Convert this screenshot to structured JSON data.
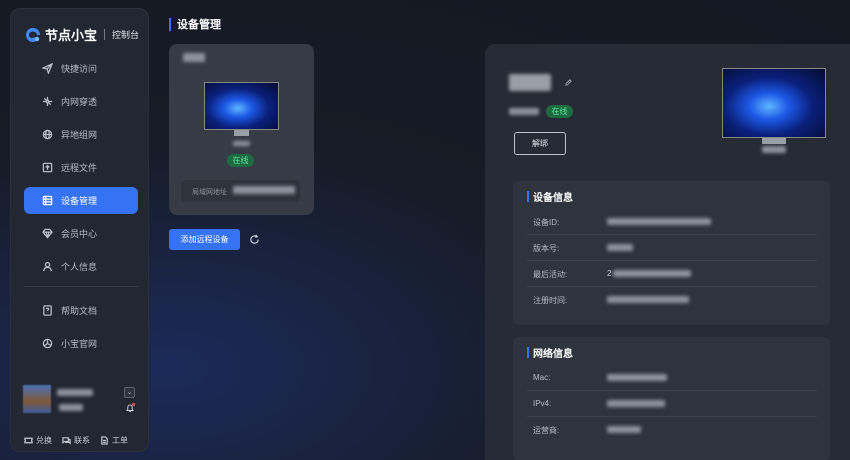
{
  "brand": {
    "name": "节点小宝",
    "subtitle": "控制台"
  },
  "sidebar": {
    "items": [
      {
        "label": "快捷访问",
        "icon": "send-icon"
      },
      {
        "label": "内网穿透",
        "icon": "network-icon"
      },
      {
        "label": "异地组网",
        "icon": "globe-icon"
      },
      {
        "label": "远程文件",
        "icon": "upload-file-icon"
      },
      {
        "label": "设备管理",
        "icon": "device-icon",
        "active": true
      },
      {
        "label": "会员中心",
        "icon": "diamond-icon"
      },
      {
        "label": "个人信息",
        "icon": "user-icon"
      }
    ],
    "secondary_items": [
      {
        "label": "帮助文档",
        "icon": "help-doc-icon"
      },
      {
        "label": "小宝官网",
        "icon": "website-icon"
      }
    ],
    "footer_links": [
      {
        "label": "兑换",
        "icon": "ticket-icon"
      },
      {
        "label": "联系",
        "icon": "chat-icon"
      },
      {
        "label": "工单",
        "icon": "document-icon"
      }
    ]
  },
  "page": {
    "title": "设备管理"
  },
  "device_card": {
    "status": "在线",
    "addr_label": "局域网地址"
  },
  "actions": {
    "add_device": "添加远程设备"
  },
  "detail": {
    "status": "在线",
    "unbind_label": "解绑",
    "device_info": {
      "title": "设备信息",
      "rows": [
        {
          "key": "设备ID:",
          "value": ""
        },
        {
          "key": "版本号:",
          "value": ""
        },
        {
          "key": "最后活动:",
          "value": "2"
        },
        {
          "key": "注册时间:",
          "value": ""
        }
      ]
    },
    "network_info": {
      "title": "网络信息",
      "rows": [
        {
          "key": "Mac:",
          "value": ""
        },
        {
          "key": "IPv4:",
          "value": ""
        },
        {
          "key": "运营商:",
          "value": ""
        }
      ]
    }
  },
  "colors": {
    "accent": "#3573f2",
    "online_bg": "#1d6b41",
    "online_text": "#5fe098"
  }
}
